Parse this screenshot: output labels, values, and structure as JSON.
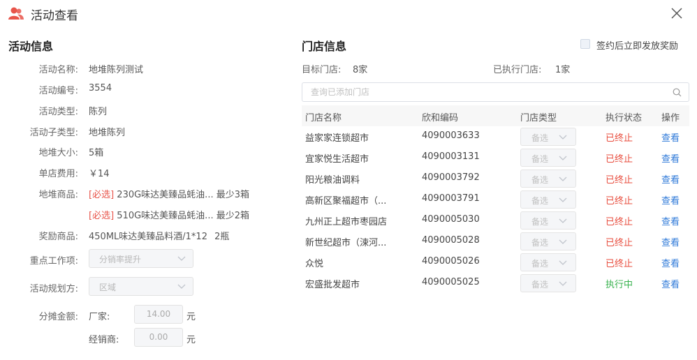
{
  "header": {
    "title": "活动查看"
  },
  "activity": {
    "section_title": "活动信息",
    "fields": [
      {
        "label": "活动名称:",
        "value": "地堆陈列测试"
      },
      {
        "label": "活动编号:",
        "value": "3554"
      },
      {
        "label": "活动类型:",
        "value": "陈列"
      },
      {
        "label": "活动子类型:",
        "value": "地堆陈列"
      },
      {
        "label": "地堆大小:",
        "value": "5箱"
      },
      {
        "label": "单店费用:",
        "value": "￥14"
      }
    ],
    "pile_goods_label": "地堆商品:",
    "pile_goods": [
      {
        "tag": "[必选]",
        "name": "230G味达美臻品蚝油...",
        "qty": "最少3箱"
      },
      {
        "tag": "[必选]",
        "name": "510G味达美臻品蚝油...",
        "qty": "最少2箱"
      }
    ],
    "reward_label": "奖励商品:",
    "reward_value": "450ML味达美臻品料酒/1*12",
    "reward_qty": "2瓶",
    "key_work_label": "重点工作项:",
    "key_work_placeholder": "分销率提升",
    "planner_label": "活动规划方:",
    "planner_placeholder": "区域",
    "split_label": "分摊金额:",
    "maker_label": "厂家:",
    "maker_amount": "14.00",
    "dealer_label": "经销商:",
    "dealer_amount": "0.00",
    "unit": "元"
  },
  "stores": {
    "section_title": "门店信息",
    "reward_checkbox_label": "签约后立即发放奖励",
    "target_label": "目标门店:",
    "target_count": "8家",
    "executed_label": "已执行门店:",
    "executed_count": "1家",
    "search_placeholder": "查询已添加门店",
    "columns": [
      "门店名称",
      "欣和编码",
      "门店类型",
      "执行状态",
      "操作"
    ],
    "type_placeholder": "备选",
    "rows": [
      {
        "name": "益家家连锁超市",
        "code": "4090003633",
        "status": "已终止",
        "action": "查看"
      },
      {
        "name": "宜家悦生活超市",
        "code": "4090003131",
        "status": "已终止",
        "action": "查看"
      },
      {
        "name": "阳光粮油调料",
        "code": "4090003792",
        "status": "已终止",
        "action": "查看"
      },
      {
        "name": "高新区聚福超市（...",
        "code": "4090003791",
        "status": "已终止",
        "action": "查看"
      },
      {
        "name": "九州正上超市枣园店",
        "code": "4090005030",
        "status": "已终止",
        "action": "查看"
      },
      {
        "name": "新世纪超市（涑河...",
        "code": "4090005028",
        "status": "已终止",
        "action": "查看"
      },
      {
        "name": "众悦",
        "code": "4090005026",
        "status": "已终止",
        "action": "查看"
      },
      {
        "name": "宏盛批发超市",
        "code": "4090005025",
        "status": "执行中",
        "action": "查看"
      }
    ]
  },
  "colors": {
    "stopped": "#e84c3d",
    "running": "#37b24d",
    "link": "#2f7ad9",
    "required": "#e8544a",
    "accent_icon": "#e8544a"
  }
}
